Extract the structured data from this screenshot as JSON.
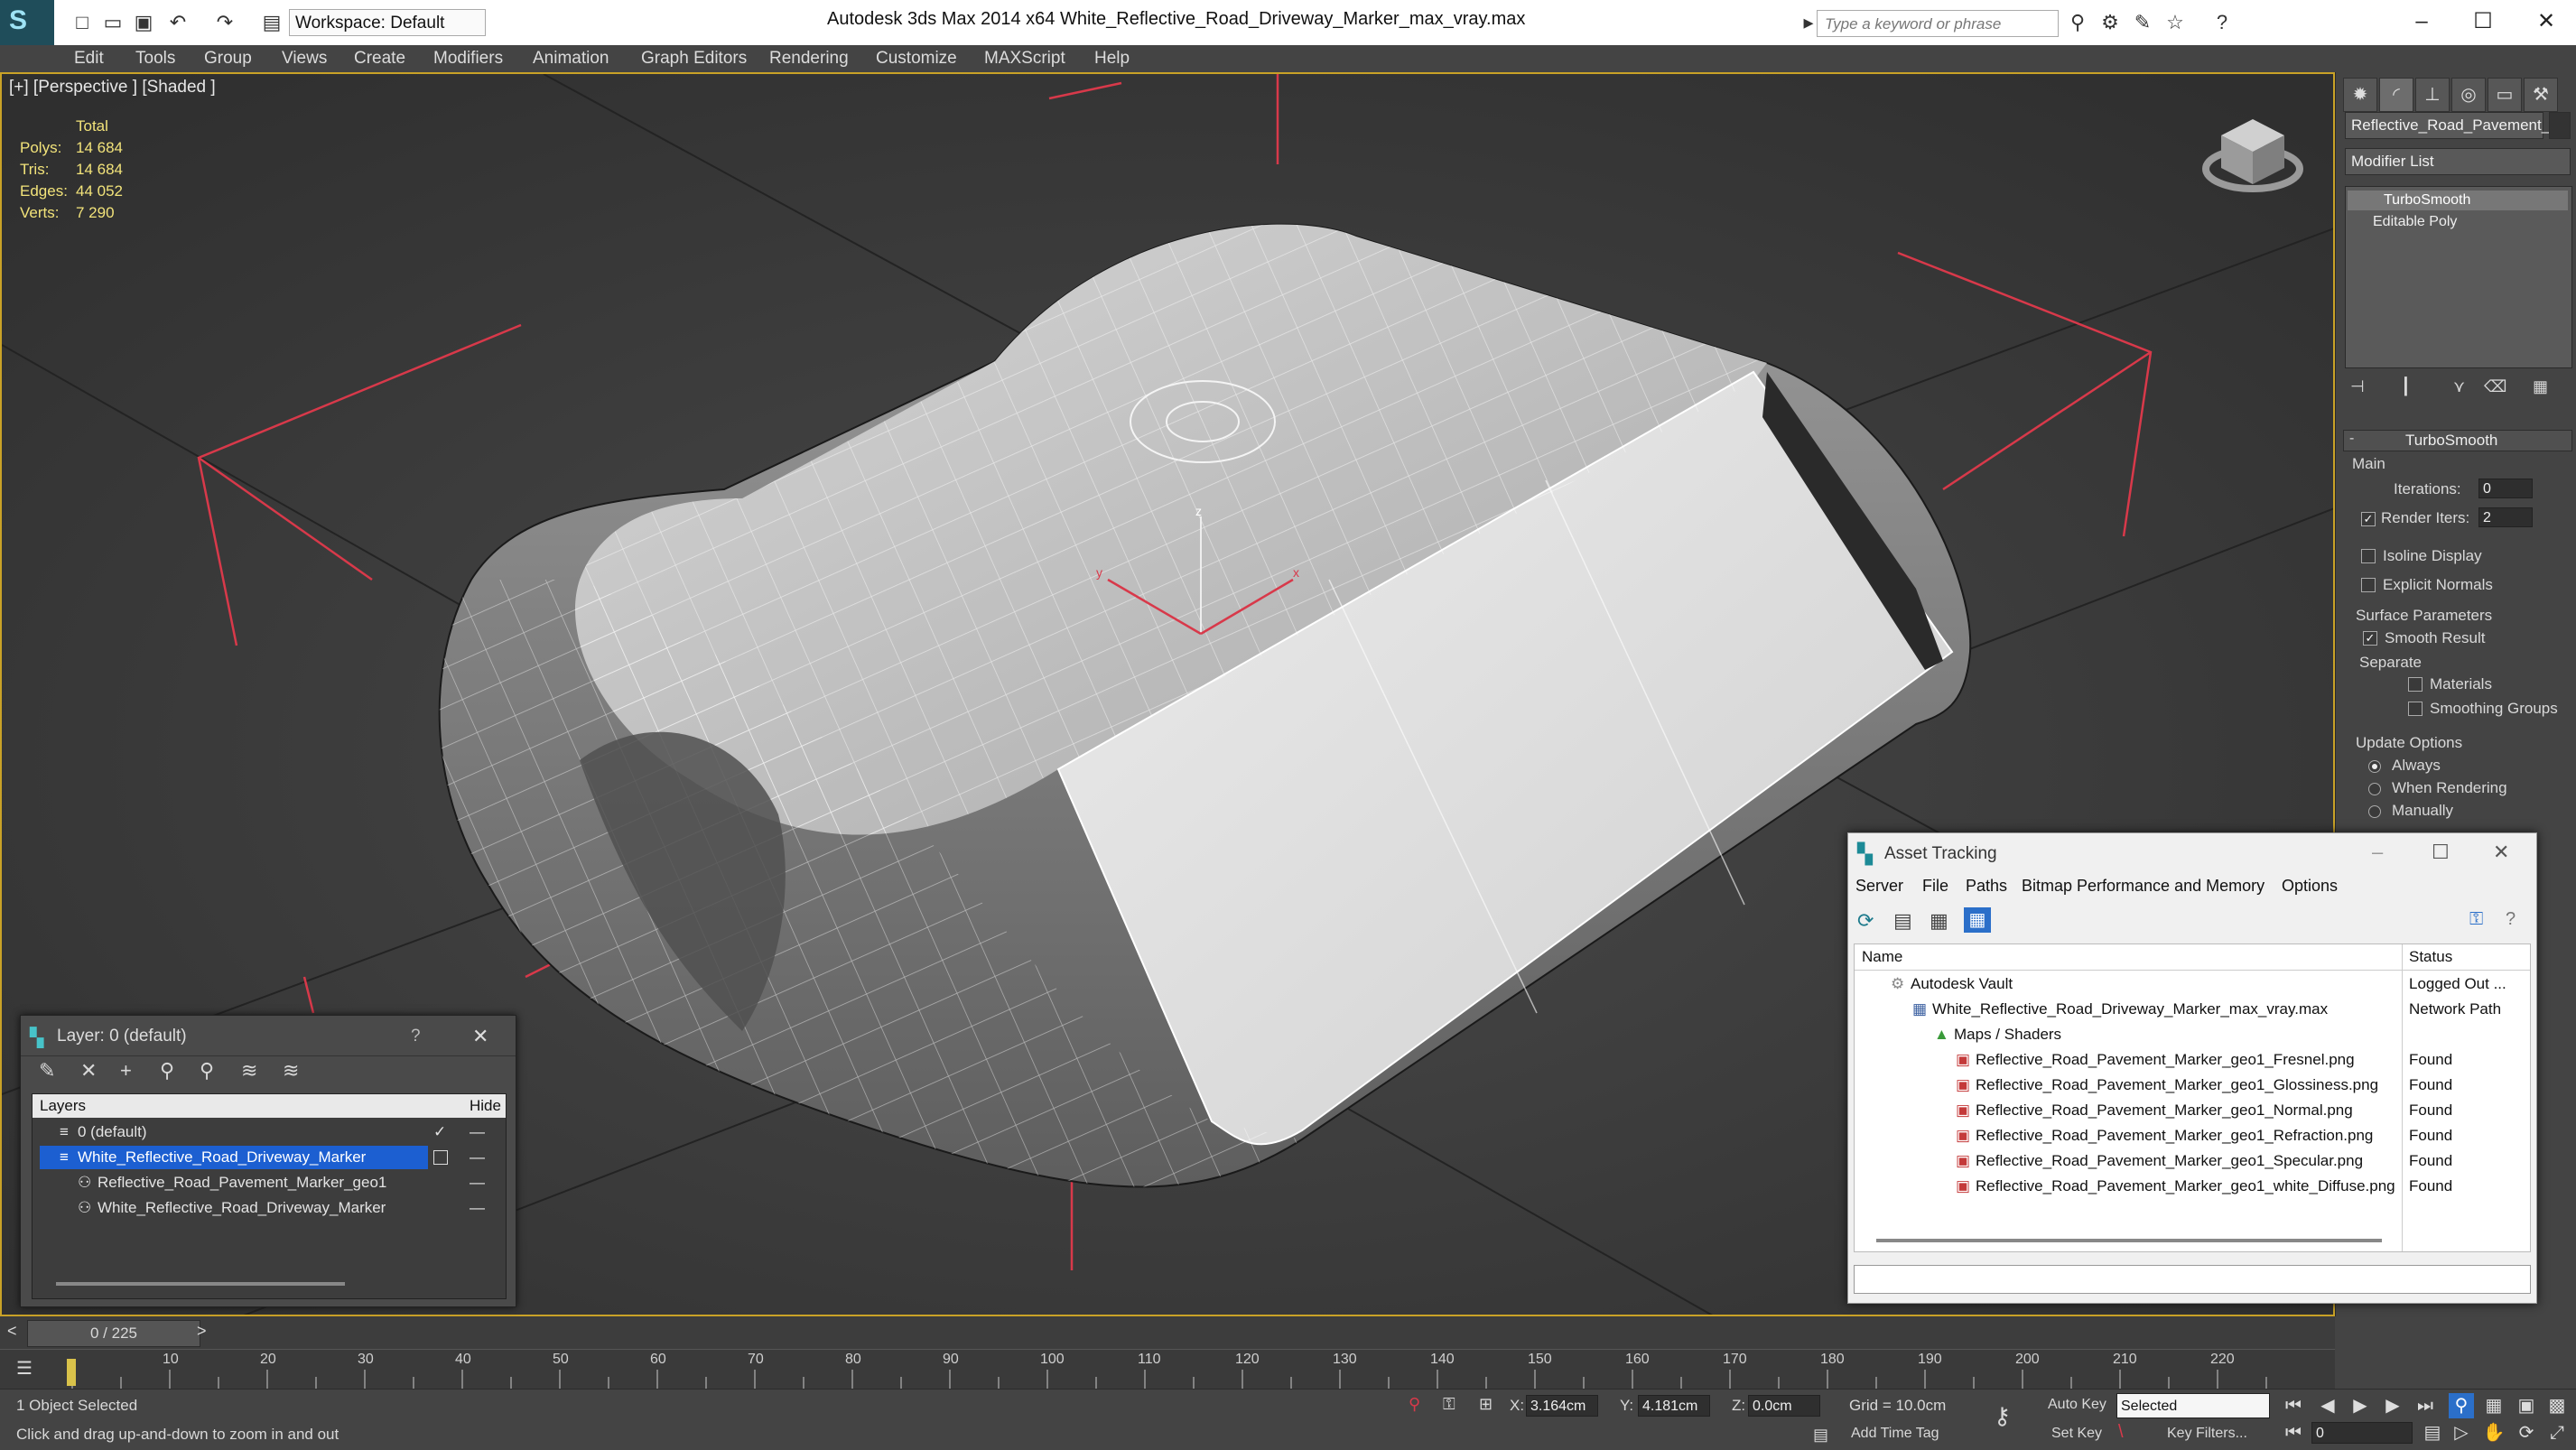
{
  "titlebar": {
    "app_title": "Autodesk 3ds Max  2014 x64",
    "file_title": "White_Reflective_Road_Driveway_Marker_max_vray.max",
    "workspace": "Workspace: Default",
    "search_placeholder": "Type a keyword or phrase"
  },
  "menu": [
    "Edit",
    "Tools",
    "Group",
    "Views",
    "Create",
    "Modifiers",
    "Animation",
    "Graph Editors",
    "Rendering",
    "Customize",
    "MAXScript",
    "Help"
  ],
  "viewport": {
    "label": "[+] [Perspective ] [Shaded ]",
    "stats_header": "Total",
    "stats": [
      {
        "label": "Polys:",
        "value": "14 684"
      },
      {
        "label": "Tris:",
        "value": "14 684"
      },
      {
        "label": "Edges:",
        "value": "44 052"
      },
      {
        "label": "Verts:",
        "value": "7 290"
      }
    ],
    "gizmo_axes": {
      "x": "x",
      "y": "y",
      "z": "z"
    }
  },
  "command_panel": {
    "object_name": "Reflective_Road_Pavement_",
    "modifier_list": "Modifier List",
    "stack": [
      "TurboSmooth",
      "Editable Poly"
    ],
    "rollout_title": "TurboSmooth",
    "main_group": "Main",
    "iterations_label": "Iterations:",
    "iterations_value": "0",
    "render_iters_label": "Render Iters:",
    "render_iters_value": "2",
    "isoline_display": "Isoline Display",
    "explicit_normals": "Explicit Normals",
    "surface_params": "Surface Parameters",
    "smooth_result": "Smooth Result",
    "separate": "Separate",
    "materials": "Materials",
    "smoothing_groups": "Smoothing Groups",
    "update_options": "Update Options",
    "always": "Always",
    "when_rendering": "When Rendering",
    "manually": "Manually"
  },
  "layer_window": {
    "title": "Layer: 0 (default)",
    "help": "?",
    "col_layers": "Layers",
    "col_hide": "Hide",
    "rows": [
      {
        "name": "0 (default)",
        "indent": 0,
        "selected": false
      },
      {
        "name": "White_Reflective_Road_Driveway_Marker",
        "indent": 0,
        "selected": true
      },
      {
        "name": "Reflective_Road_Pavement_Marker_geo1",
        "indent": 1,
        "selected": false
      },
      {
        "name": "White_Reflective_Road_Driveway_Marker",
        "indent": 1,
        "selected": false
      }
    ]
  },
  "asset_window": {
    "title": "Asset Tracking",
    "menu": [
      "Server",
      "File",
      "Paths",
      "Bitmap Performance and Memory",
      "Options"
    ],
    "col_name": "Name",
    "col_status": "Status",
    "rows": [
      {
        "name": "Autodesk Vault",
        "status": "Logged Out ...",
        "indent": 0
      },
      {
        "name": "White_Reflective_Road_Driveway_Marker_max_vray.max",
        "status": "Network Path",
        "indent": 1
      },
      {
        "name": "Maps / Shaders",
        "status": "",
        "indent": 2
      },
      {
        "name": "Reflective_Road_Pavement_Marker_geo1_Fresnel.png",
        "status": "Found",
        "indent": 3
      },
      {
        "name": "Reflective_Road_Pavement_Marker_geo1_Glossiness.png",
        "status": "Found",
        "indent": 3
      },
      {
        "name": "Reflective_Road_Pavement_Marker_geo1_Normal.png",
        "status": "Found",
        "indent": 3
      },
      {
        "name": "Reflective_Road_Pavement_Marker_geo1_Refraction.png",
        "status": "Found",
        "indent": 3
      },
      {
        "name": "Reflective_Road_Pavement_Marker_geo1_Specular.png",
        "status": "Found",
        "indent": 3
      },
      {
        "name": "Reflective_Road_Pavement_Marker_geo1_white_Diffuse.png",
        "status": "Found",
        "indent": 3
      }
    ]
  },
  "timeline": {
    "frame_counter": "0 / 225",
    "ticks": [
      "10",
      "20",
      "30",
      "40",
      "50",
      "60",
      "70",
      "80",
      "90",
      "100",
      "110",
      "120",
      "130",
      "140",
      "150",
      "160",
      "170",
      "180",
      "190",
      "200",
      "210",
      "220"
    ]
  },
  "status": {
    "selection": "1 Object Selected",
    "prompt": "Click and drag up-and-down to zoom in and out",
    "x_label": "X:",
    "x_value": "3.164cm",
    "y_label": "Y:",
    "y_value": "4.181cm",
    "z_label": "Z:",
    "z_value": "0.0cm",
    "grid": "Grid = 10.0cm",
    "auto_key": "Auto Key",
    "set_key": "Set Key",
    "selected_value": "Selected",
    "key_filters": "Key Filters...",
    "frame_value": "0",
    "add_time_tag": "Add Time Tag"
  },
  "colors": {
    "viewport_border": "#c9a227",
    "stats_text": "#f2e37a",
    "selection_blue": "#1c5fd1",
    "axis_red": "#d8394a"
  }
}
